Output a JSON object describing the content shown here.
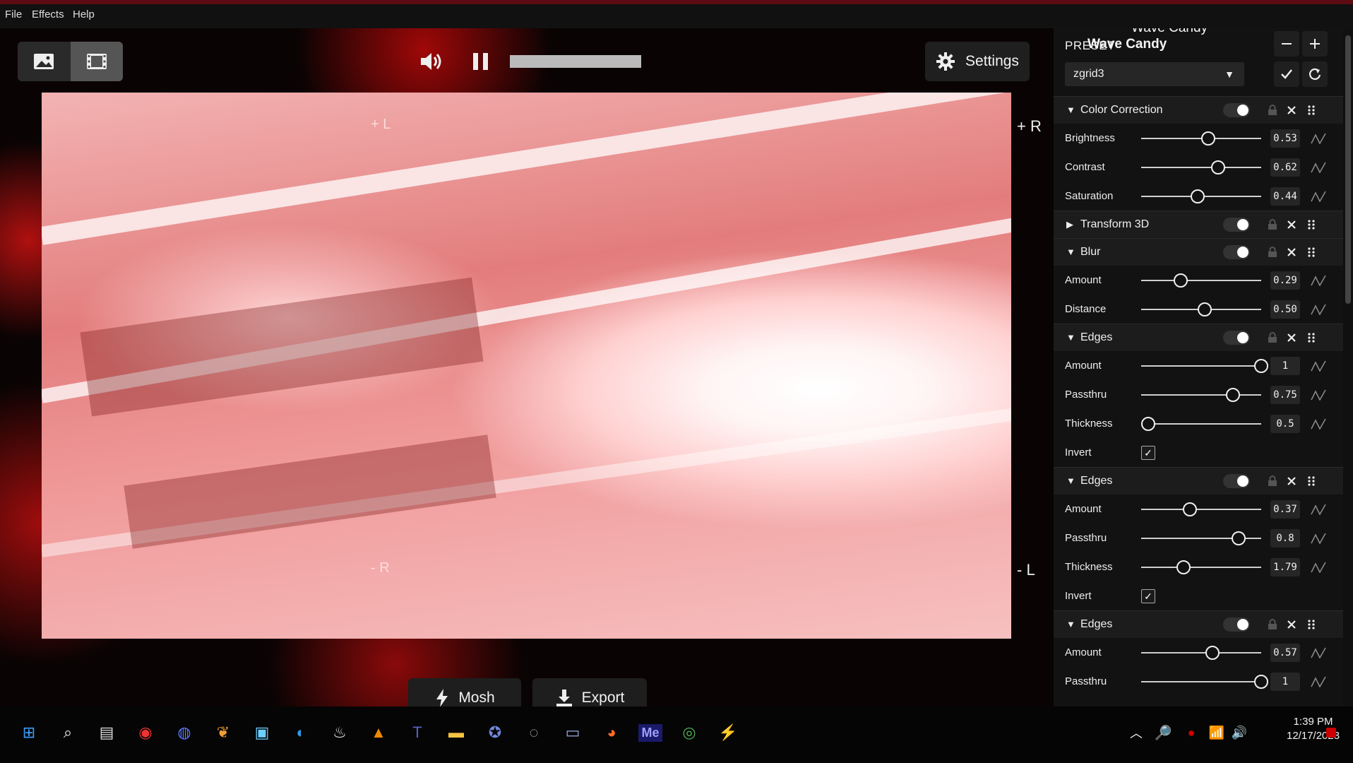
{
  "menu": {
    "file": "File",
    "effects": "Effects",
    "help": "Help"
  },
  "view_toggle": {
    "image_icon": "image-icon",
    "video_icon": "film-icon",
    "active": "video"
  },
  "playback": {
    "volume_icon": "volume-icon",
    "pause_icon": "pause-icon",
    "progress": 1.0
  },
  "settings": {
    "label": "Settings",
    "icon": "gear-icon"
  },
  "scope_labels": {
    "top_right": "+ R",
    "bottom_right": "- L",
    "top_inner": "+ L",
    "bottom_inner": "- R"
  },
  "actions": {
    "mosh": "Mosh",
    "export": "Export"
  },
  "panel": {
    "title_top": "Wave Candy",
    "title_overlap": "Wave Candy",
    "preset_label": "PRESET",
    "preset_value": "zgrid3",
    "effects": [
      {
        "name": "Color Correction",
        "expanded": true,
        "enabled": true,
        "params": [
          {
            "label": "Brightness",
            "value": "0.53",
            "level": 0.53
          },
          {
            "label": "Contrast",
            "value": "0.62",
            "level": 0.62
          },
          {
            "label": "Saturation",
            "value": "0.44",
            "level": 0.44
          }
        ]
      },
      {
        "name": "Transform 3D",
        "expanded": false,
        "enabled": true,
        "params": []
      },
      {
        "name": "Blur",
        "expanded": true,
        "enabled": true,
        "params": [
          {
            "label": "Amount",
            "value": "0.29",
            "level": 0.29
          },
          {
            "label": "Distance",
            "value": "0.50",
            "level": 0.5
          }
        ]
      },
      {
        "name": "Edges",
        "expanded": true,
        "enabled": true,
        "params": [
          {
            "label": "Amount",
            "value": "1",
            "level": 1.0
          },
          {
            "label": "Passthru",
            "value": "0.75",
            "level": 0.75
          },
          {
            "label": "Thickness",
            "value": "0.5",
            "level": 0.0
          },
          {
            "label": "Invert",
            "checkbox": true,
            "checked": true
          }
        ]
      },
      {
        "name": "Edges",
        "expanded": true,
        "enabled": true,
        "params": [
          {
            "label": "Amount",
            "value": "0.37",
            "level": 0.37
          },
          {
            "label": "Passthru",
            "value": "0.8",
            "level": 0.8
          },
          {
            "label": "Thickness",
            "value": "1.79",
            "level": 0.31
          },
          {
            "label": "Invert",
            "checkbox": true,
            "checked": true
          }
        ]
      },
      {
        "name": "Edges",
        "expanded": true,
        "enabled": true,
        "params": [
          {
            "label": "Amount",
            "value": "0.57",
            "level": 0.57
          },
          {
            "label": "Passthru",
            "value": "1",
            "level": 1.0
          }
        ]
      }
    ]
  },
  "taskbar": {
    "apps": [
      "windows-start-icon",
      "search-icon",
      "file-icon",
      "screen-recorder-icon",
      "browser-extension-icon",
      "carrot-icon",
      "snipping-tool-icon",
      "edge-icon",
      "steam-icon",
      "vlc-icon",
      "teams-icon",
      "file-explorer-icon",
      "discord-icon",
      "obs-icon",
      "monitor-icon",
      "firefox-icon",
      "media-encoder-icon",
      "chrome-icon",
      "mosh-app-icon"
    ],
    "media_encoder_text": "Me",
    "time": "1:39 PM",
    "date": "12/17/2023"
  }
}
